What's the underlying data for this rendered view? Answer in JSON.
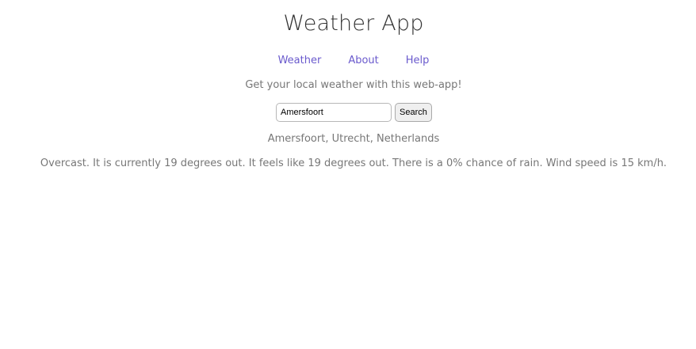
{
  "header": {
    "title": "Weather App"
  },
  "nav": {
    "items": [
      {
        "label": "Weather"
      },
      {
        "label": "About"
      },
      {
        "label": "Help"
      }
    ]
  },
  "intro": {
    "text": "Get your local weather with this web-app!"
  },
  "search": {
    "value": "Amersfoort",
    "button_label": "Search"
  },
  "result": {
    "location": "Amersfoort, Utrecht, Netherlands",
    "forecast": "Overcast. It is currently 19 degrees out. It feels like 19 degrees out. There is a 0% chance of rain. Wind speed is 15 km/h."
  },
  "colors": {
    "link": "#6a5acd",
    "text": "#777777",
    "title": "#333333"
  }
}
